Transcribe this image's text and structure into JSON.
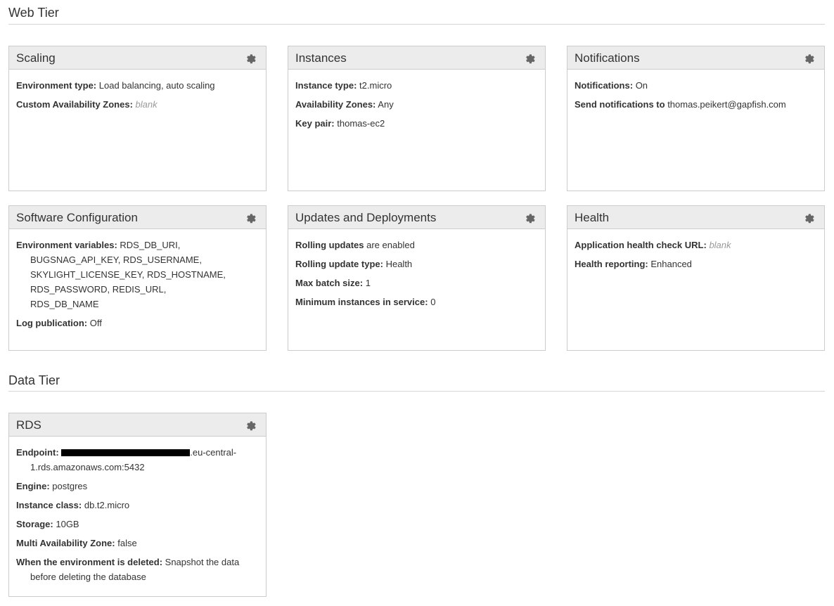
{
  "web_tier": {
    "title": "Web Tier",
    "scaling": {
      "title": "Scaling",
      "env_type_label": "Environment type:",
      "env_type_value": "Load balancing, auto scaling",
      "custom_az_label": "Custom Availability Zones:",
      "custom_az_value": "blank"
    },
    "instances": {
      "title": "Instances",
      "instance_type_label": "Instance type:",
      "instance_type_value": "t2.micro",
      "az_label": "Availability Zones:",
      "az_value": "Any",
      "key_pair_label": "Key pair:",
      "key_pair_value": "thomas-ec2"
    },
    "notifications": {
      "title": "Notifications",
      "notifications_label": "Notifications:",
      "notifications_value": "On",
      "send_to_label": "Send notifications to",
      "send_to_value": "thomas.peikert@gapfish.com"
    },
    "software": {
      "title": "Software Configuration",
      "env_vars_label": "Environment variables:",
      "env_vars_value": "RDS_DB_URI, BUGSNAG_API_KEY, RDS_USERNAME, SKYLIGHT_LICENSE_KEY, RDS_HOSTNAME, RDS_PASSWORD, REDIS_URL, RDS_DB_NAME",
      "log_pub_label": "Log publication:",
      "log_pub_value": "Off"
    },
    "updates": {
      "title": "Updates and Deployments",
      "rolling_updates_label": "Rolling updates",
      "rolling_updates_value": "are enabled",
      "rolling_type_label": "Rolling update type:",
      "rolling_type_value": "Health",
      "max_batch_label": "Max batch size:",
      "max_batch_value": "1",
      "min_instances_label": "Minimum instances in service:",
      "min_instances_value": "0"
    },
    "health": {
      "title": "Health",
      "health_url_label": "Application health check URL:",
      "health_url_value": "blank",
      "health_reporting_label": "Health reporting:",
      "health_reporting_value": "Enhanced"
    }
  },
  "data_tier": {
    "title": "Data Tier",
    "rds": {
      "title": "RDS",
      "endpoint_label": "Endpoint:",
      "endpoint_value": ".eu-central-1.rds.amazonaws.com:5432",
      "engine_label": "Engine:",
      "engine_value": "postgres",
      "instance_class_label": "Instance class:",
      "instance_class_value": "db.t2.micro",
      "storage_label": "Storage:",
      "storage_value": "10GB",
      "multi_az_label": "Multi Availability Zone:",
      "multi_az_value": "false",
      "deleted_label": "When the environment is deleted:",
      "deleted_value": "Snapshot the data before deleting the database"
    }
  },
  "icons": {
    "panel_settings": "gear-icon"
  },
  "colors": {
    "panel_header_bg": "#ececec",
    "panel_border": "#cccccc",
    "muted_text": "#999999"
  }
}
